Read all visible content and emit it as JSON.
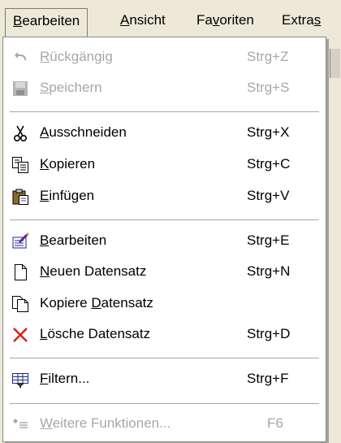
{
  "menubar": {
    "items": [
      {
        "pre": "",
        "acc": "B",
        "post": "earbeiten"
      },
      {
        "pre": "",
        "acc": "A",
        "post": "nsicht"
      },
      {
        "pre": "Fa",
        "acc": "v",
        "post": "oriten"
      },
      {
        "pre": "Extra",
        "acc": "s",
        "post": ""
      }
    ]
  },
  "menu": {
    "undo": {
      "pre": "",
      "acc": "R",
      "post": "ückgängig",
      "shortcut": "Strg+Z",
      "icon": "undo-arrow-icon"
    },
    "save": {
      "pre": "",
      "acc": "S",
      "post": "peichern",
      "shortcut": "Strg+S",
      "icon": "floppy-disk-icon"
    },
    "cut": {
      "pre": "",
      "acc": "A",
      "post": "usschneiden",
      "shortcut": "Strg+X",
      "icon": "scissors-icon"
    },
    "copy": {
      "pre": "",
      "acc": "K",
      "post": "opieren",
      "shortcut": "Strg+C",
      "icon": "copy-icon"
    },
    "paste": {
      "pre": "",
      "acc": "E",
      "post": "infügen",
      "shortcut": "Strg+V",
      "icon": "paste-icon"
    },
    "edit": {
      "pre": "",
      "acc": "B",
      "post": "earbeiten",
      "shortcut": "Strg+E",
      "icon": "edit-record-icon"
    },
    "new_record": {
      "pre": "",
      "acc": "N",
      "post": "euen Datensatz",
      "shortcut": "Strg+N",
      "icon": "new-document-icon"
    },
    "copy_record": {
      "pre": "Kopiere ",
      "acc": "D",
      "post": "atensatz",
      "shortcut": "",
      "icon": "copy-document-icon"
    },
    "delete_record": {
      "pre": "",
      "acc": "L",
      "post": "ösche Datensatz",
      "shortcut": "Strg+D",
      "icon": "delete-x-icon"
    },
    "filter": {
      "pre": "",
      "acc": "F",
      "post": "iltern...",
      "shortcut": "Strg+F",
      "icon": "filter-icon"
    },
    "more": {
      "pre": "",
      "acc": "W",
      "post": "eitere  Funktionen...",
      "shortcut": "F6",
      "icon": "more-functions-icon"
    }
  },
  "colors": {
    "menubar_bg": "#ece9d8",
    "menu_bg": "#ffffff",
    "disabled_text": "#a7a6aa"
  }
}
